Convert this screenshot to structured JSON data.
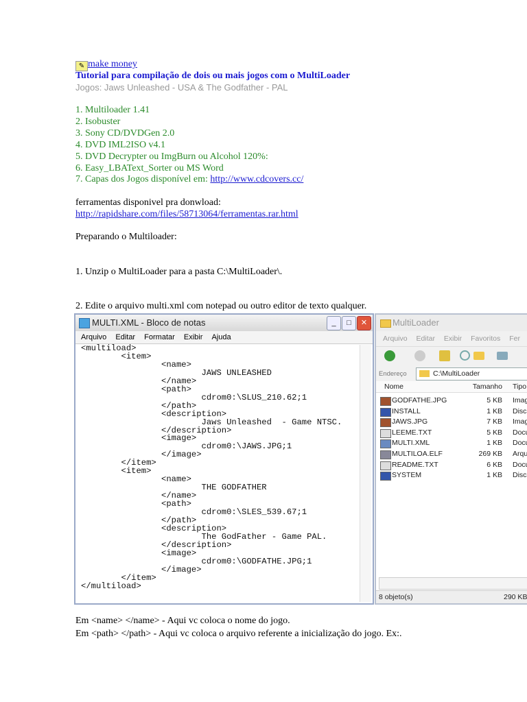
{
  "header": {
    "link_icon": "hand-pointer-icon",
    "link_text": "make money",
    "title": "Tutorial para compilação de dois ou mais jogos com o MultiLoader",
    "subtitle": "Jogos: Jaws Unleashed - USA & The Godfather - PAL"
  },
  "tools": [
    "1. Multiloader 1.41",
    "2. Isobuster",
    "3. Sony CD/DVDGen 2.0",
    "4. DVD IML2ISO v4.1",
    "5. DVD Decrypter ou ImgBurn ou Alcohol 120%:",
    "6. Easy_LBAText_Sorter ou MS Word"
  ],
  "tools_last": {
    "text": "7. Capas dos Jogos disponível em: ",
    "link": "http://www.cdcovers.cc/"
  },
  "download": {
    "text": "ferramentas disponivel pra donwload:",
    "link": "http://rapidshare.com/files/58713064/ferramentas.rar.html"
  },
  "prep_heading": "Preparando o Multiloader:",
  "step1": "1. Unzip o MultiLoader para a pasta C:\\MultiLoader\\.",
  "step2": "2. Edite o arquivo multi.xml com notepad ou outro editor de texto qualquer.",
  "notepad": {
    "title": "MULTI.XML - Bloco de notas",
    "menu": [
      "Arquivo",
      "Editar",
      "Formatar",
      "Exibir",
      "Ajuda"
    ],
    "content": "<multiload>\n\t<item>\n\t\t<name>\n\t\t\tJAWS UNLEASHED\n\t\t</name>\n\t\t<path>\n\t\t\tcdrom0:\\SLUS_210.62;1\n\t\t</path>\n\t\t<description>\n\t\t\tJaws Unleashed  - Game NTSC.\n\t\t</description>\n\t\t<image>\n\t\t\tcdrom0:\\JAWS.JPG;1\n\t\t</image>\n\t</item>\n\t<item>\n\t\t<name>\n\t\t\tTHE GODFATHER\n\t\t</name>\n\t\t<path>\n\t\t\tcdrom0:\\SLES_539.67;1\n\t\t</path>\n\t\t<description>\n\t\t\tThe GodFather - Game PAL.\n\t\t</description>\n\t\t<image>\n\t\t\tcdrom0:\\GODFATHE.JPG;1\n\t\t</image>\n\t</item>\n</multiload>"
  },
  "explorer": {
    "title": "MultiLoader",
    "menu": [
      "Arquivo",
      "Editar",
      "Exibir",
      "Favoritos",
      "Fer"
    ],
    "address_label": "Endereço",
    "address": "C:\\MultiLoader",
    "columns": [
      "Nome",
      "Tamanho",
      "Tipo"
    ],
    "files": [
      {
        "name": "GODFATHE.JPG",
        "size": "5 KB",
        "type": "Imag",
        "icon": "image-file-icon"
      },
      {
        "name": "INSTALL",
        "size": "1 KB",
        "type": "Disca",
        "icon": "disc-image-icon"
      },
      {
        "name": "JAWS.JPG",
        "size": "7 KB",
        "type": "Imag",
        "icon": "image-file-icon"
      },
      {
        "name": "LEEME.TXT",
        "size": "5 KB",
        "type": "Docu",
        "icon": "text-file-icon"
      },
      {
        "name": "MULTI.XML",
        "size": "1 KB",
        "type": "Docu",
        "icon": "xml-file-icon"
      },
      {
        "name": "MULTILOA.ELF",
        "size": "269 KB",
        "type": "Arqu",
        "icon": "binary-file-icon"
      },
      {
        "name": "README.TXT",
        "size": "6 KB",
        "type": "Docu",
        "icon": "text-file-icon"
      },
      {
        "name": "SYSTEM",
        "size": "1 KB",
        "type": "Disca",
        "icon": "disc-image-icon"
      }
    ],
    "status_count": "8 objeto(s)",
    "status_size": "290 KB"
  },
  "explain": [
    "Em <name> </name> - Aqui vc coloca o nome do jogo.",
    "Em <path> </path> - Aqui vc coloca o arquivo referente a inicialização do jogo. Ex:."
  ],
  "colors": {
    "link": "#1a1ad0",
    "title": "#1a1ad0",
    "subtitle": "#999999",
    "list": "#2a8a2a"
  }
}
